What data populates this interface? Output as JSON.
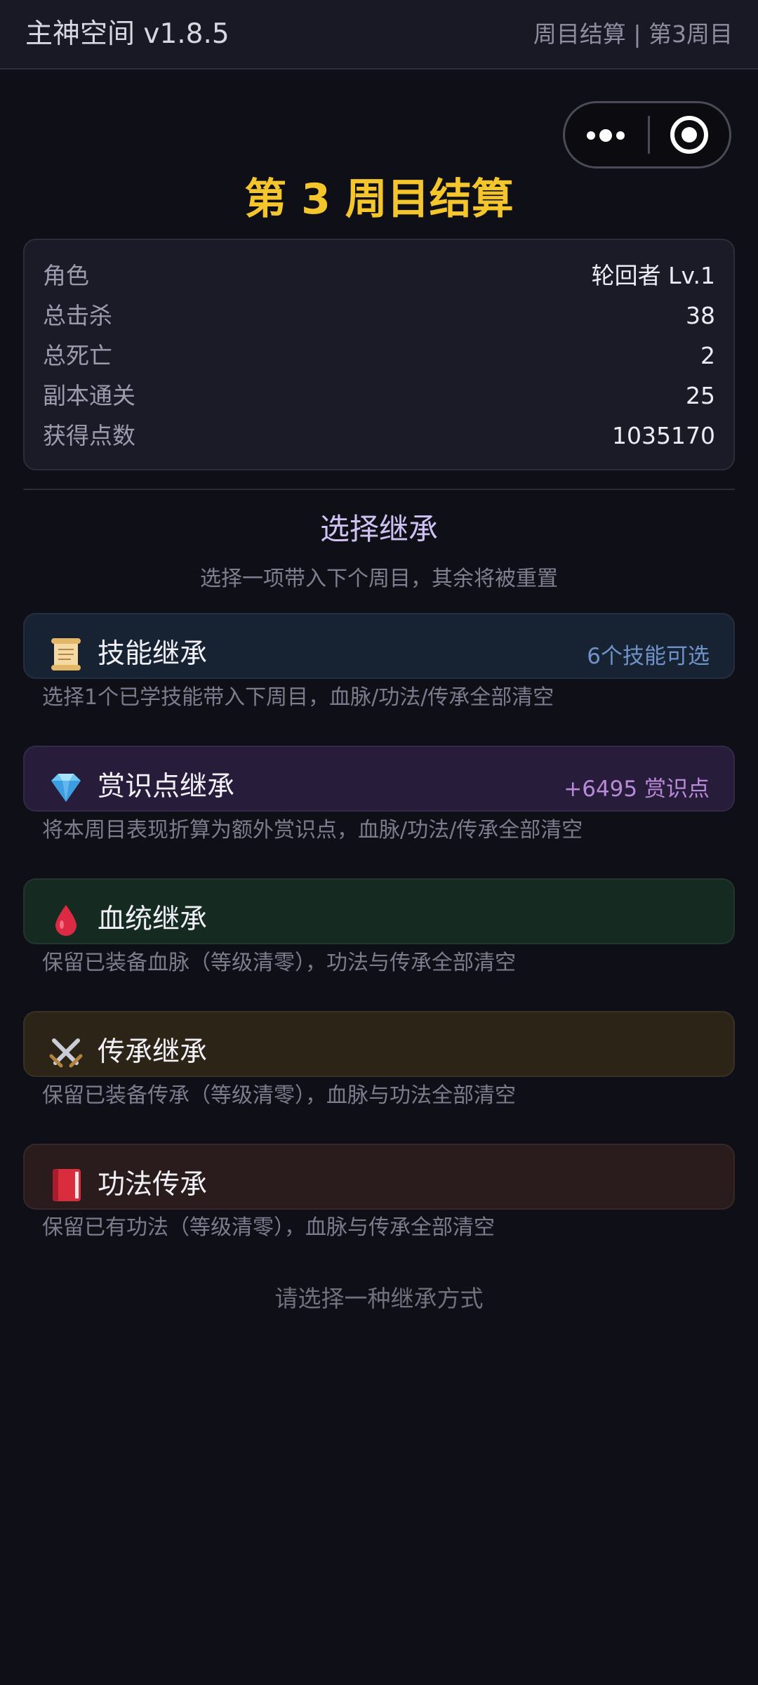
{
  "header": {
    "title": "主神空间 v1.8.5",
    "subtitle": "周目结算 | 第3周目"
  },
  "capsule": {
    "more_icon": "more-dots-icon",
    "close_icon": "target-close-icon"
  },
  "round_title": "第 3 周目结算",
  "stats": [
    {
      "label": "角色",
      "value": "轮回者 Lv.1"
    },
    {
      "label": "总击杀",
      "value": "38"
    },
    {
      "label": "总死亡",
      "value": "2"
    },
    {
      "label": "副本通关",
      "value": "25"
    },
    {
      "label": "获得点数",
      "value": "1035170"
    }
  ],
  "inherit": {
    "title": "选择继承",
    "subtitle": "选择一项带入下个周目，其余将被重置",
    "options": [
      {
        "icon": "scroll-icon",
        "name": "技能继承",
        "tag": "6个技能可选",
        "desc": "选择1个已学技能带入下周目，血脉/功法/传承全部清空",
        "bg": "#172332",
        "tag_color": "#6f93c9"
      },
      {
        "icon": "diamond-icon",
        "name": "赏识点继承",
        "tag": "+6495 赏识点",
        "desc": "将本周目表现折算为额外赏识点，血脉/功法/传承全部清空",
        "bg": "#271c3a",
        "tag_color": "#b98ad8"
      },
      {
        "icon": "blood-drop-icon",
        "name": "血统继承",
        "tag": "",
        "desc": "保留已装备血脉（等级清零），功法与传承全部清空",
        "bg": "#152a20",
        "tag_color": "#ffffff"
      },
      {
        "icon": "crossed-swords-icon",
        "name": "传承继承",
        "tag": "",
        "desc": "保留已装备传承（等级清零），血脉与功法全部清空",
        "bg": "#2c2517",
        "tag_color": "#ffffff"
      },
      {
        "icon": "red-book-icon",
        "name": "功法传承",
        "tag": "",
        "desc": "保留已有功法（等级清零），血脉与传承全部清空",
        "bg": "#2a1b1c",
        "tag_color": "#ffffff"
      }
    ],
    "prompt": "请选择一种继承方式"
  }
}
